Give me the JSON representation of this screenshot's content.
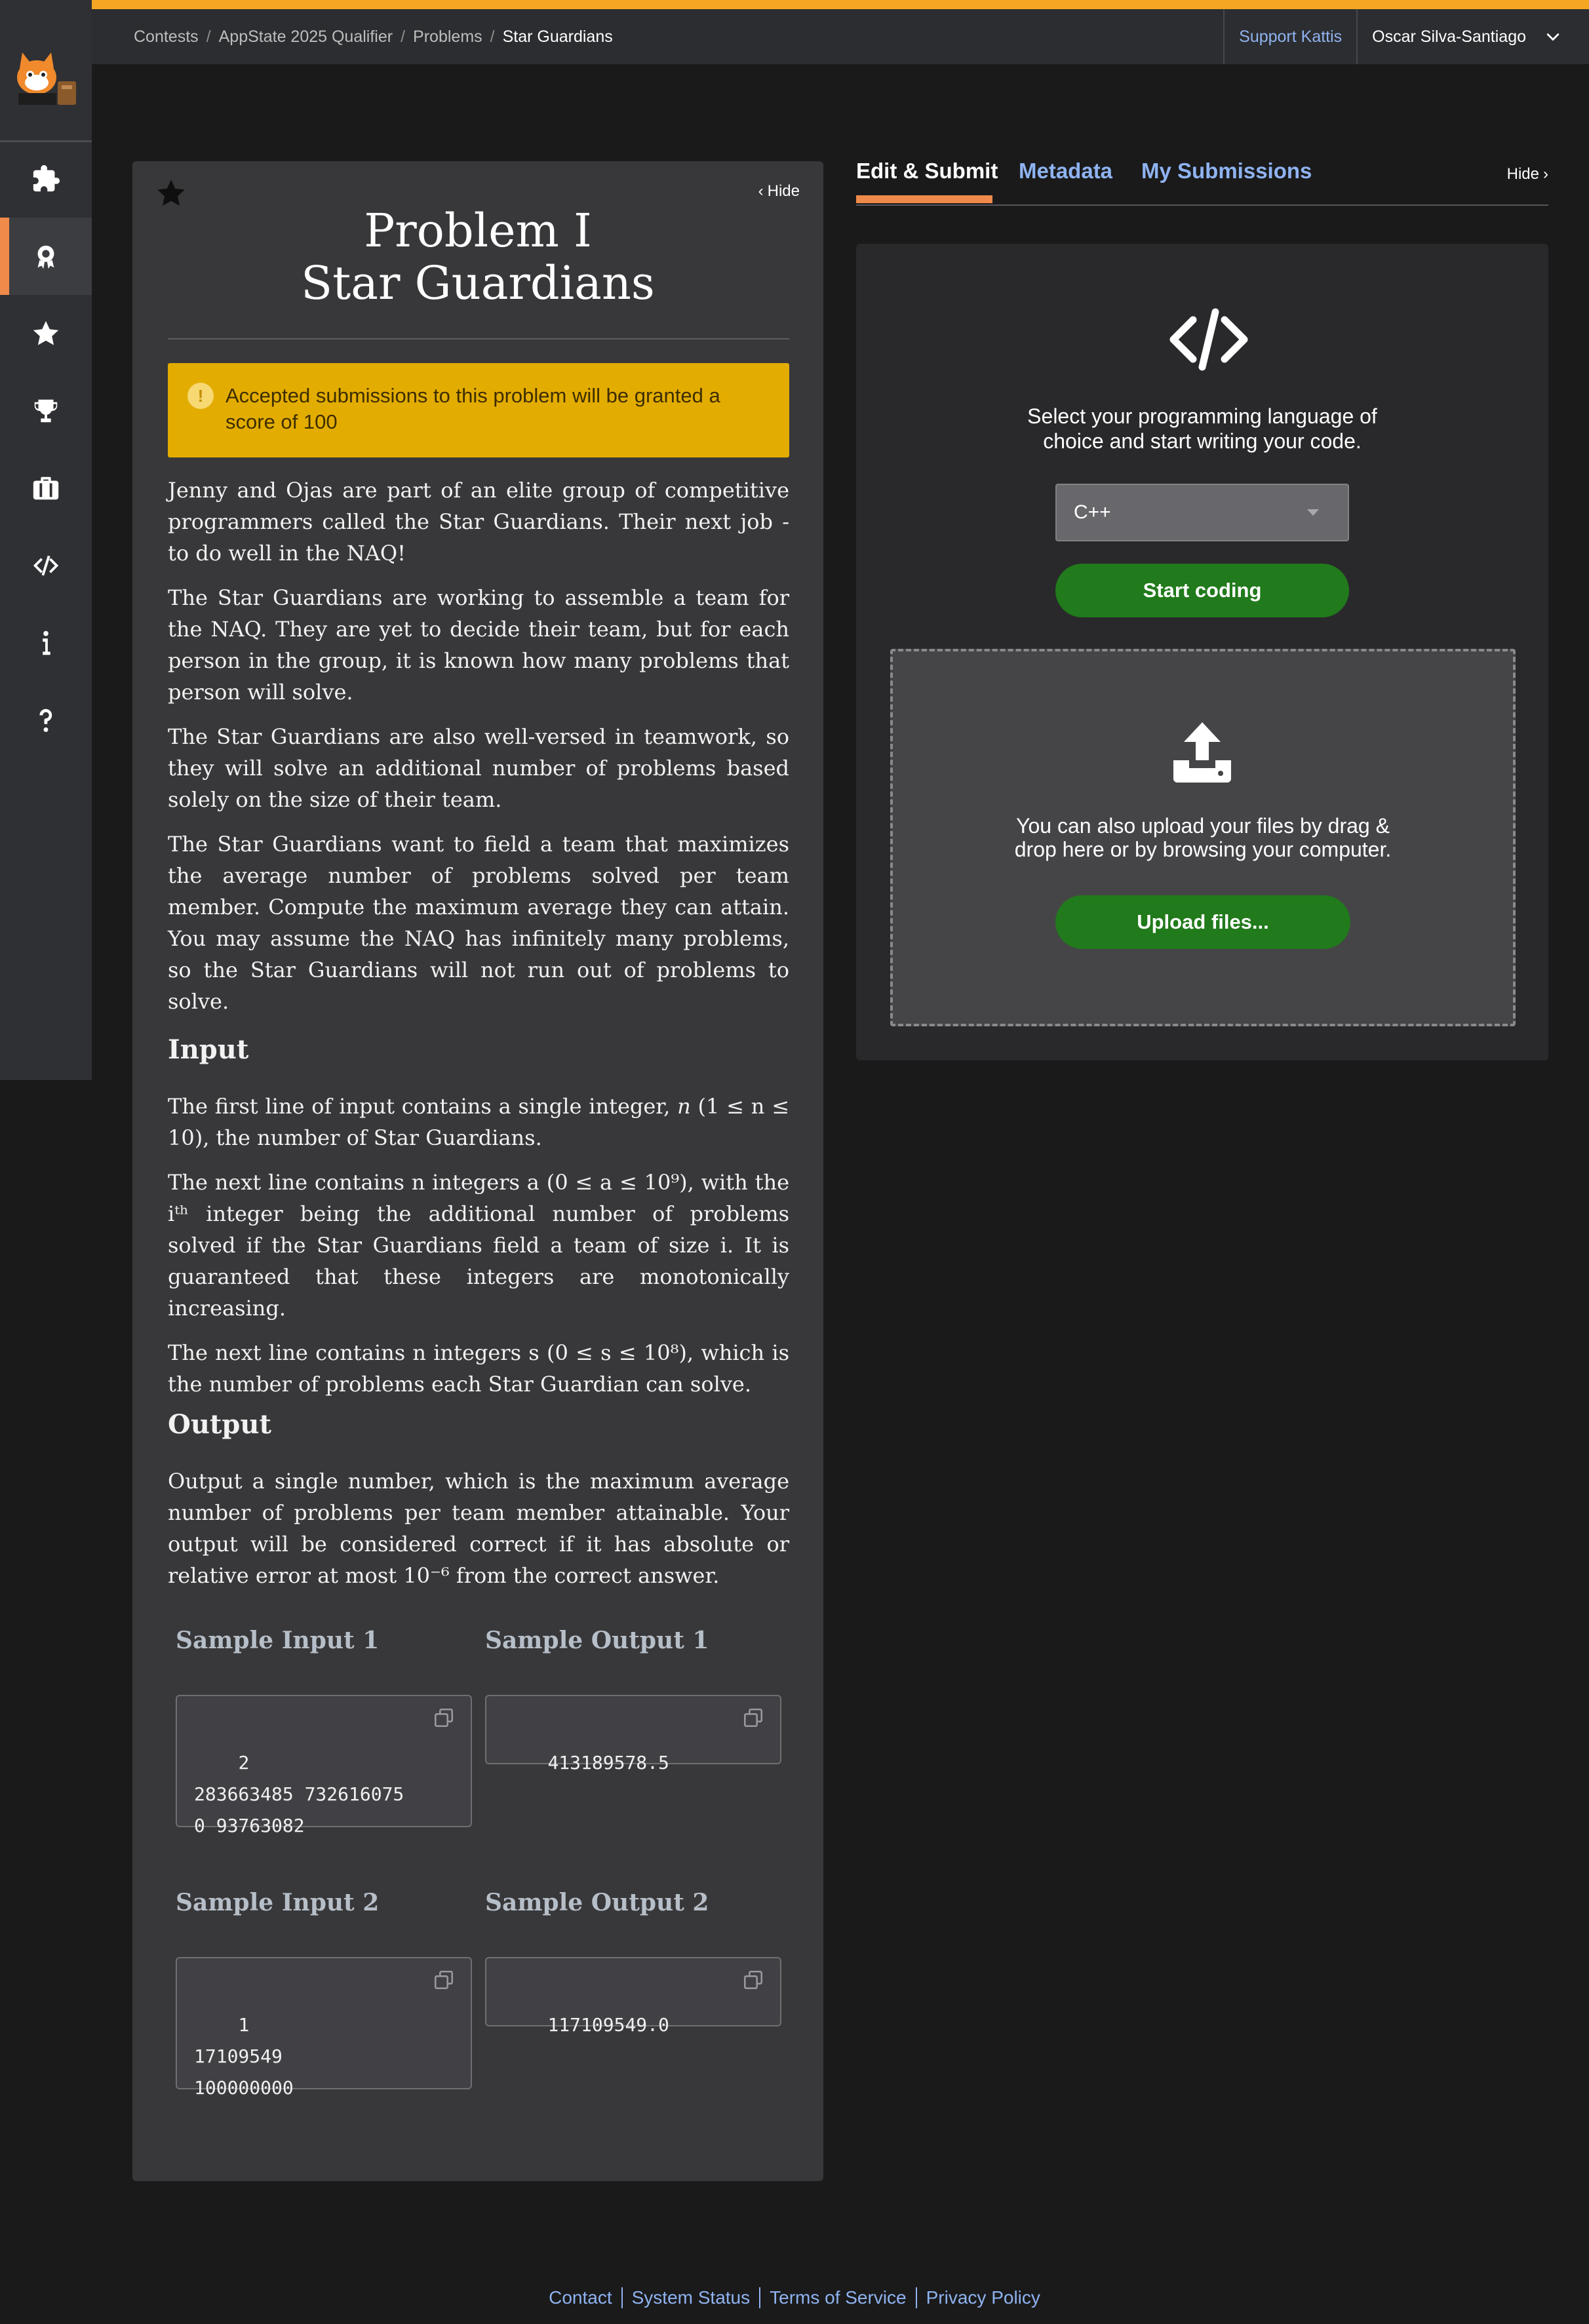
{
  "header": {
    "breadcrumb": [
      "Contests",
      "AppState 2025 Qualifier",
      "Problems",
      "Star Guardians"
    ],
    "support_label": "Support Kattis",
    "user_name": "Oscar Silva-Santiago"
  },
  "colors": {
    "accent": "#f5a623",
    "active_tab": "#f08a4b",
    "link": "#8fb3f0",
    "notice": "#e3ac00",
    "button": "#217a1b"
  },
  "sidebar": {
    "items": [
      {
        "icon": "puzzle-icon"
      },
      {
        "icon": "contest-badge-icon",
        "active": true
      },
      {
        "icon": "star-icon"
      },
      {
        "icon": "trophy-icon"
      },
      {
        "icon": "briefcase-icon"
      },
      {
        "icon": "code-icon"
      },
      {
        "icon": "info-icon"
      },
      {
        "icon": "help-icon"
      }
    ]
  },
  "problem": {
    "hide_label": "Hide",
    "title_line1": "Problem I",
    "title_line2": "Star Guardians",
    "notice": "Accepted submissions to this problem will be granted a score of 100",
    "paragraphs": [
      "Jenny and Ojas are part of an elite group of competitive programmers called the Star Guardians. Their next job - to do well in the NAQ!",
      "The Star Guardians are working to assemble a team for the NAQ. They are yet to decide their team, but for each person in the group, it is known how many problems that person will solve.",
      "The Star Guardians are also well-versed in teamwork, so they will solve an additional number of problems based solely on the size of their team.",
      "The Star Guardians want to field a team that maximizes the average number of problems solved per team member. Compute the maximum average they can attain. You may assume the NAQ has infinitely many problems, so the Star Guardians will not run out of problems to solve."
    ],
    "input_heading": "Input",
    "input_p1_a": "The first line of input contains a single integer, ",
    "input_p1_b": "n",
    "input_p1_c": " (1 ≤ n ≤ 10), the number of Star Guardians.",
    "input_p2": "The next line contains n integers a (0 ≤ a ≤ 10⁹), with the iᵗʰ integer being the additional number of problems solved if the Star Guardians field a team of size i. It is guaranteed that these integers are monotonically increasing.",
    "input_p3": "The next line contains n integers s (0 ≤ s ≤ 10⁸), which is the number of problems each Star Guardian can solve.",
    "output_heading": "Output",
    "output_p": "Output a single number, which is the maximum average number of problems per team member attainable. Your output will be considered correct if it has absolute or relative error at most 10⁻⁶ from the correct answer.",
    "samples": [
      {
        "input_title": "Sample Input 1",
        "output_title": "Sample Output 1",
        "input": "2\n283663485 732616075\n0 93763082",
        "output": "413189578.5"
      },
      {
        "input_title": "Sample Input 2",
        "output_title": "Sample Output 2",
        "input": "1\n17109549\n100000000",
        "output": "117109549.0"
      }
    ]
  },
  "tabs": {
    "edit": "Edit & Submit",
    "metadata": "Metadata",
    "submissions": "My Submissions",
    "hide_label": "Hide"
  },
  "editor": {
    "prompt": "Select your programming language of choice and start writing your code.",
    "language": "C++",
    "start_button": "Start coding",
    "upload_text": "You can also upload your files by drag & drop here or by browsing your computer.",
    "upload_button": "Upload files..."
  },
  "footer": {
    "links": [
      "Contact",
      "System Status",
      "Terms of Service",
      "Privacy Policy"
    ]
  }
}
